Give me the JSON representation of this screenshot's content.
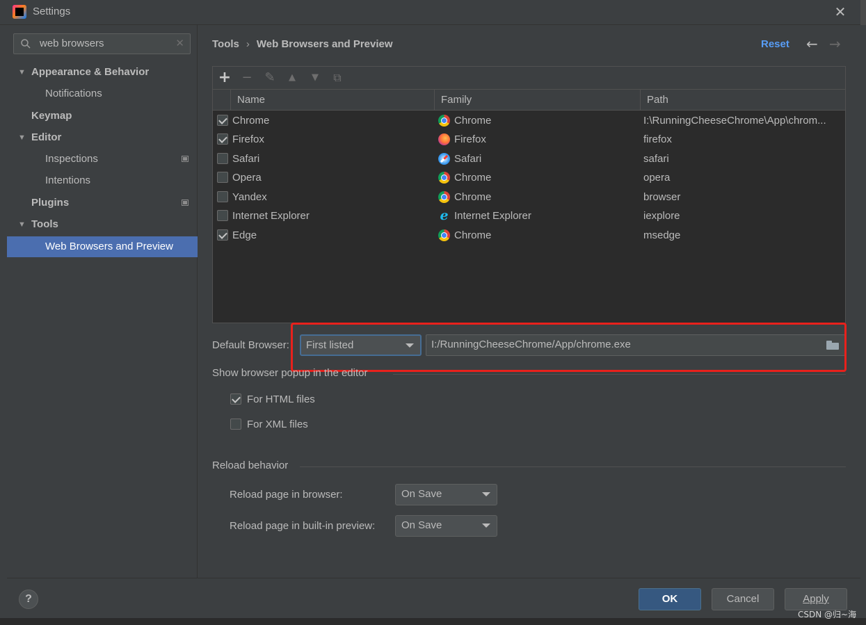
{
  "window": {
    "title": "Settings"
  },
  "search": {
    "value": "web browsers"
  },
  "sidebar": {
    "items": [
      {
        "label": "Appearance & Behavior"
      },
      {
        "label": "Notifications"
      },
      {
        "label": "Keymap"
      },
      {
        "label": "Editor"
      },
      {
        "label": "Inspections"
      },
      {
        "label": "Intentions"
      },
      {
        "label": "Plugins"
      },
      {
        "label": "Tools"
      },
      {
        "label": "Web Browsers and Preview"
      }
    ]
  },
  "breadcrumb": {
    "parent": "Tools",
    "separator": "›",
    "current": "Web Browsers and Preview"
  },
  "header": {
    "reset_label": "Reset"
  },
  "table": {
    "columns": [
      "Name",
      "Family",
      "Path"
    ],
    "rows": [
      {
        "checked": true,
        "name": "Chrome",
        "family": "Chrome",
        "family_icon": "chrome-icon",
        "path": "I:\\RunningCheeseChrome\\App\\chrom..."
      },
      {
        "checked": true,
        "name": "Firefox",
        "family": "Firefox",
        "family_icon": "firefox-icon",
        "path": "firefox"
      },
      {
        "checked": false,
        "name": "Safari",
        "family": "Safari",
        "family_icon": "safari-icon",
        "path": "safari"
      },
      {
        "checked": false,
        "name": "Opera",
        "family": "Chrome",
        "family_icon": "chrome-icon",
        "path": "opera"
      },
      {
        "checked": false,
        "name": "Yandex",
        "family": "Chrome",
        "family_icon": "chrome-icon",
        "path": "browser"
      },
      {
        "checked": false,
        "name": "Internet Explorer",
        "family": "Internet Explorer",
        "family_icon": "ie-icon",
        "path": "iexplore"
      },
      {
        "checked": true,
        "name": "Edge",
        "family": "Chrome",
        "family_icon": "chrome-icon",
        "path": "msedge"
      }
    ]
  },
  "default_browser": {
    "label": "Default Browser:",
    "selected": "First listed",
    "path": "I:/RunningCheeseChrome/App/chrome.exe"
  },
  "popup": {
    "title": "Show browser popup in the editor",
    "options": [
      {
        "label": "For HTML files",
        "checked": true
      },
      {
        "label": "For XML files",
        "checked": false
      }
    ]
  },
  "reload": {
    "title": "Reload behavior",
    "browser_label": "Reload page in browser:",
    "browser_value": "On Save",
    "preview_label": "Reload page in built-in preview:",
    "preview_value": "On Save"
  },
  "footer": {
    "help": "?",
    "ok": "OK",
    "cancel": "Cancel",
    "apply": "Apply"
  },
  "watermark": "CSDN @归~海",
  "colors": {
    "accent": "#4b6eaf",
    "link": "#589df6",
    "highlight_box": "#e8211c",
    "primary_button": "#365880"
  }
}
